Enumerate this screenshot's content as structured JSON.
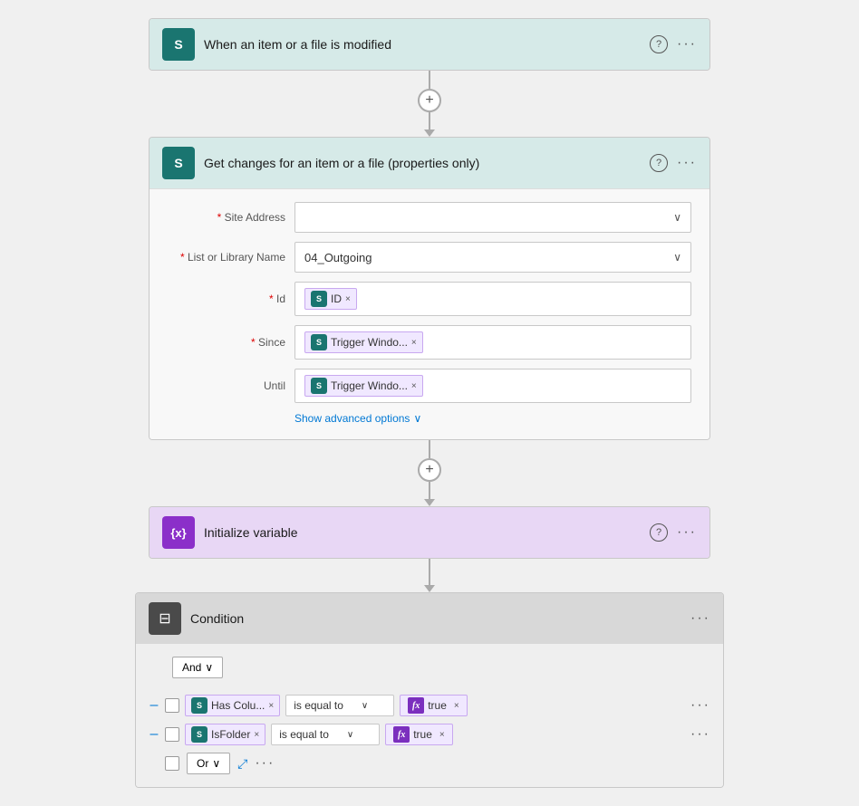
{
  "flow": {
    "step1": {
      "title": "When an item or a file is modified",
      "icon_label": "S",
      "help": "?",
      "ellipsis": "..."
    },
    "step2": {
      "title": "Get changes for an item or a file (properties only)",
      "icon_label": "S",
      "help": "?",
      "ellipsis": "...",
      "fields": {
        "site_address": {
          "label": "Site Address",
          "required": true,
          "placeholder": ""
        },
        "list_name": {
          "label": "List or Library Name",
          "required": true,
          "value": "04_Outgoing"
        },
        "id": {
          "label": "Id",
          "required": true,
          "tag_text": "ID",
          "tag_close": "×"
        },
        "since": {
          "label": "Since",
          "required": true,
          "tag_text": "Trigger Windo...",
          "tag_close": "×"
        },
        "until": {
          "label": "Until",
          "required": false,
          "tag_text": "Trigger Windo...",
          "tag_close": "×"
        }
      },
      "show_advanced": "Show advanced options"
    },
    "step3": {
      "title": "Initialize variable",
      "icon_label": "{x}",
      "help": "?",
      "ellipsis": "..."
    },
    "step4": {
      "title": "Condition",
      "ellipsis": "...",
      "and_label": "And",
      "condition_rows": [
        {
          "value_tag": "Has Colu...",
          "operator": "is equal to",
          "result_tag": "true",
          "tag_close": "×"
        },
        {
          "value_tag": "IsFolder",
          "operator": "is equal to",
          "result_tag": "true",
          "tag_close": "×"
        }
      ],
      "or_label": "Or"
    }
  },
  "icons": {
    "plus": "+",
    "chevron_down": "∨",
    "chevron_small": "⌄",
    "close": "×",
    "collapse": "⤢",
    "ellipsis": "···"
  }
}
